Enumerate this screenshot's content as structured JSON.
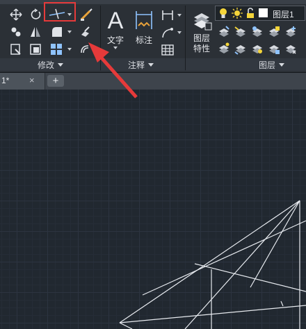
{
  "ribbon": {
    "panels": {
      "modify": {
        "title": "修改"
      },
      "annotate": {
        "title": "注释",
        "text_label": "文字",
        "dimension_label": "标注"
      },
      "layers": {
        "title": "图层",
        "layer_props_label_line1": "图层",
        "layer_props_label_line2": "特性",
        "current_layer": "图层1"
      }
    }
  },
  "tabs": [
    {
      "label": "1*",
      "close": "×"
    }
  ],
  "tab_add": "+",
  "colors": {
    "highlight": "#e63a3a",
    "arrow": "#e63a3a",
    "canvas_bg": "#212830",
    "ribbon_bg": "#2b3036",
    "drawing_lines": "#e8ebf0"
  },
  "icons": [
    "move-icon",
    "rotate-icon",
    "trim-icon",
    "draw-line-icon",
    "copy-icon",
    "mirror-icon",
    "fillet-icon",
    "edit-icon",
    "stretch-icon",
    "scale-icon",
    "array-icon",
    "offset-icon",
    "text-icon",
    "dimension-icon",
    "linear-dim-icon",
    "leader-icon",
    "table-icon",
    "layer-properties-icon",
    "bulb-icon",
    "sun-icon",
    "lock-icon",
    "color-swatch-icon"
  ]
}
